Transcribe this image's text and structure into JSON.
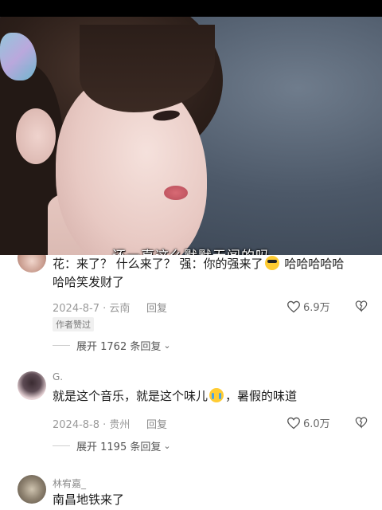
{
  "video": {
    "subtitle": "还一直这么默默无闻的吗"
  },
  "comments": [
    {
      "username": "",
      "text_line1_parts": [
        "花：来了？ 什么来了？   强：你的强来了",
        "  哈哈哈哈哈"
      ],
      "text_line2": "哈哈笑发财了",
      "emoji1": "smiling-face-with-sunglasses",
      "date": "2024-8-7 · 云南",
      "reply_label": "回复",
      "likes": "6.9万",
      "badge": "作者赞过",
      "expand_label": "展开 1762 条回复"
    },
    {
      "username": "G.",
      "text_parts": [
        "就是这个音乐，就是这个味儿",
        "，暑假的味道"
      ],
      "emoji1": "loudly-crying-face",
      "date": "2024-8-8 · 贵州",
      "reply_label": "回复",
      "likes": "6.0万",
      "expand_label": "展开 1195 条回复"
    },
    {
      "username": "林宥嘉_",
      "text": "南昌地铁来了"
    }
  ]
}
